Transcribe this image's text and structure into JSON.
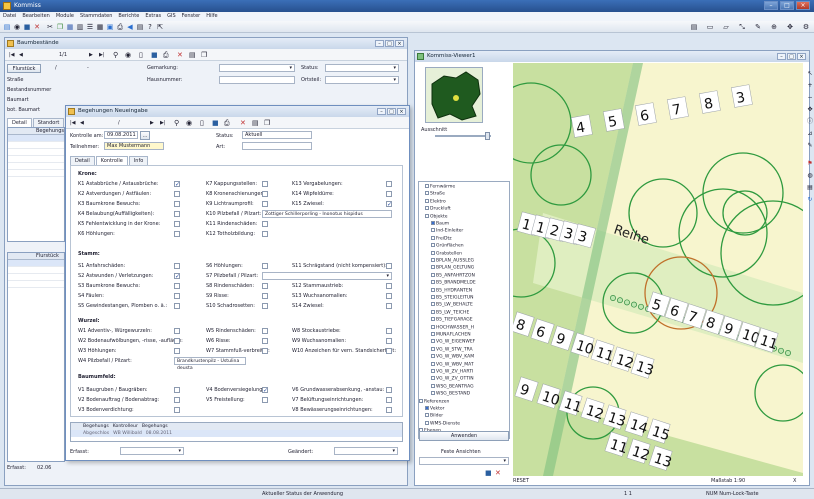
{
  "app": {
    "title": "Kommiss",
    "min": "–",
    "max": "□",
    "close": "×"
  },
  "menu": [
    "Datei",
    "Bearbeiten",
    "Module",
    "Stammdaten",
    "Berichte",
    "Extras",
    "GIS",
    "Fenster",
    "Hilfe"
  ],
  "baum": {
    "title": "Baumbestände",
    "nav": "1/1",
    "flurstueck_btn": "Flurstück",
    "dash": "/",
    "dot": "-",
    "gemarkung": "Gemarkung:",
    "status": "Status:",
    "hausnummer": "Hausnummer:",
    "ortsteil": "Ortsteil:",
    "side_labels": [
      "Straße",
      "Bestandsnummer",
      "Baumart",
      "bot. Baumart"
    ],
    "detail_tabs": [
      "Detail",
      "Standort"
    ],
    "grid_header": "Begehungs",
    "grid2_header": "Flurstück",
    "erfasst": "Erfasst:",
    "erfasst_val": "02.06"
  },
  "dialog": {
    "title": "Begehungen Neueingabe",
    "nav_dash": "/",
    "kontrolle_label": "Kontrolle am:",
    "kontrolle_date": "09.08.2011",
    "status_label": "Status:",
    "status_val": "Aktuell",
    "teilnehmer_label": "Teilnehmer:",
    "teilnehmer_val": "Max Mustermann",
    "art_label": "Art:",
    "tabs": [
      "Detail",
      "Kontrolle",
      "Info"
    ],
    "krone": "Krone:",
    "stamm": "Stamm:",
    "wurzel": "Wurzel:",
    "baum": "Baumumfeld:",
    "k1": [
      "K1 Astabbrüche / Astausbrüche:",
      "K2 Astverdungen / Astfäulen:",
      "K3 Baumkrone Bewuchs:",
      "K4 Belaubung(Auffälligkeiten):",
      "K5 Fehlentwicklung in der Krone:",
      "K6 Höhlungen:"
    ],
    "k2": [
      "K7 Kappungsstellen:",
      "K8 Kronenschienungen:",
      "K9 Lichtraumprofil:",
      "K10 Pilzbefall / Pilzart:",
      "K11 Rindenschäden:",
      "K12 Totholzbildung:"
    ],
    "k3": [
      "K13 Vergabelungen:",
      "K14 Wipfeldürre:",
      "K15 Zwiesel:"
    ],
    "pilz_val": "Zottiger Schillerporling - Inonotus hispidus",
    "s1": [
      "S1 Anfahrschäden:",
      "S2 Astwunden / Verletzungen:",
      "S3 Baumkrone Bewuchs:",
      "S4 Fäulen:",
      "S5 Gewindestangen, Plomben o. ä.:"
    ],
    "s2": [
      "S6 Höhlungen:",
      "S7 Pilzbefall / Pilzart:",
      "S8 Rindenschäden:",
      "S9 Risse:",
      "S10 Schadrosetten:"
    ],
    "s3": [
      "S11 Schrägstand (nicht kompensiert):",
      "S12 Stammaustrieb:",
      "S13 Wuchsanomalien:",
      "S14 Zwiesel:"
    ],
    "w1": [
      "W1 Adventiv-, Würgewurzeln:",
      "W2 Bodenaufwölbungen, -risse, -aufläufe:",
      "W3 Höhlungen:",
      "W4 Pilzbefall / Pilzart:"
    ],
    "w2": [
      "W5 Rindenschäden:",
      "W6 Risse:",
      "W7 Stammfuß-verbreiter:"
    ],
    "w3": [
      "W8 Stockaustriebe:",
      "W9 Wuchsanomalien:",
      "W10 Anzeichen für vern. Standsicherheit:"
    ],
    "w4_val": "Brandkrustenpilz - Ustulina deusta",
    "v1": [
      "V1 Baugruben / Baugräben:",
      "V2 Bodenauftrag / Bodenabtrag:",
      "V3 Bodenverdichtung:"
    ],
    "v2": [
      "V4 Bodenversiegelung:",
      "V5 Freistellung:"
    ],
    "v3": [
      "V6 Grundwasserabsenkung, -anstau:",
      "V7 Belüftungseinrichtungen:",
      "V8 Bewässerungseinrichtungen:"
    ],
    "bottom_headers": [
      "Begehungs",
      "Kontrolleur",
      "Begehungs"
    ],
    "bottom_row": [
      "Abgeschlos",
      "WB Willibald",
      "08.08.2011"
    ],
    "erfasst": "Erfasst:",
    "geaendert": "Geändert:"
  },
  "map": {
    "title": "Kommiss-Viewer1",
    "ausschnitt": "Ausschnitt",
    "tree": [
      "Fernwärme",
      "Straße",
      "Elektro",
      "Druckluft",
      "Objekte",
      "Baum",
      "Ind-Einleiter",
      "FreiDtz",
      "Grünflächen",
      "Grabstellen",
      "BPLAN_AUSSLEG",
      "BPLAN_GELTUNG",
      "B5_ANFAHRTZON",
      "B5_BRANDMELDE",
      "B5_HYDRANTEN",
      "B5_STEIGLEITUN",
      "B5_LW_BEHALTE",
      "B5_LW_TEICHE",
      "B5_TIEFGARAGE",
      "HOCHWASSER_H",
      "MUNAFLACHEN",
      "VG_W_EIGENWEF",
      "VG_W_STW_TRA",
      "VG_W_WBV_KAM",
      "VG_W_WBV_MAT",
      "VG_W_ZV_HARTI",
      "VG_W_ZV_OTTIN",
      "WSG_BEANTRAG",
      "WSG_BESTAND",
      "Referenzen",
      "Vektor",
      "Bilder",
      "WMS-Dienste",
      "Ebenen"
    ],
    "anwenden": "Anwenden",
    "feste": "Feste Ansichten",
    "street": "Reihe",
    "numbers_top": [
      "4",
      "5",
      "6",
      "7",
      "8",
      "3"
    ],
    "numbers_row1": [
      "1",
      "1",
      "2",
      "3",
      "3"
    ],
    "numbers_row2": [
      "5",
      "6",
      "7",
      "8",
      "9",
      "10",
      "11"
    ],
    "numbers_row3": [
      "8",
      "6",
      "9",
      "10",
      "11",
      "12",
      "13"
    ],
    "numbers_row4": [
      "9",
      "10",
      "11",
      "12",
      "13",
      "14",
      "15"
    ],
    "numbers_row5": [
      "11",
      "12",
      "13"
    ],
    "reset": "RESET",
    "massstab": "Maßstab  1:90",
    "x": "X"
  },
  "status": {
    "text": "Aktueller Status der Anwendung",
    "coords": "1  1",
    "numlock": "NUM Num-Lock-Taste"
  }
}
